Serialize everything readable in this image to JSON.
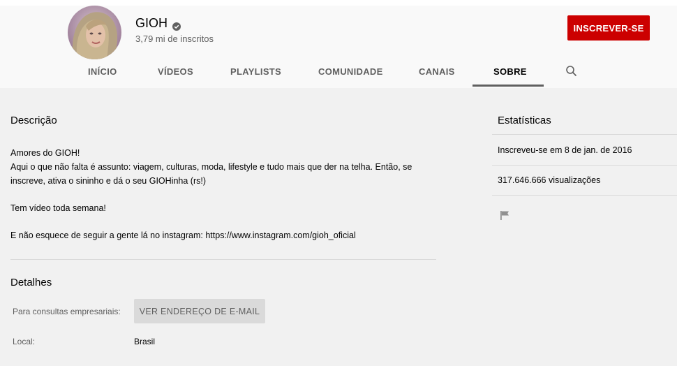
{
  "channel": {
    "name": "GIOH",
    "subscribers": "3,79 mi de inscritos",
    "avatar_icon": "avatar-image",
    "verified_icon": "verified-check-icon"
  },
  "subscribe_label": "INSCREVER-SE",
  "tabs": [
    {
      "label": "INÍCIO",
      "active": false
    },
    {
      "label": "VÍDEOS",
      "active": false
    },
    {
      "label": "PLAYLISTS",
      "active": false
    },
    {
      "label": "COMUNIDADE",
      "active": false
    },
    {
      "label": "CANAIS",
      "active": false
    },
    {
      "label": "SOBRE",
      "active": true
    }
  ],
  "search_icon": "search-icon",
  "description": {
    "title": "Descrição",
    "lines": [
      "Amores do GIOH!",
      "Aqui o que não falta é assunto: viagem, culturas, moda, lifestyle e tudo mais que der na telha. Então, se inscreve, ativa o sininho e dá o seu GIOHinha (rs!)",
      "Tem vídeo toda semana!",
      "E não esquece de seguir a gente lá no instagram: https://www.instagram.com/gioh_oficial"
    ]
  },
  "details": {
    "title": "Detalhes",
    "business_label": "Para consultas empresariais:",
    "email_button": "VER ENDEREÇO DE E-MAIL",
    "location_label": "Local:",
    "location_value": "Brasil"
  },
  "stats": {
    "title": "Estatísticas",
    "joined": "Inscreveu-se em 8 de jan. de 2016",
    "views": "317.646.666 visualizações",
    "flag_icon": "flag-icon"
  },
  "colors": {
    "subscribe": "#cc0000",
    "header_bg": "#f9f9f9",
    "content_bg": "#f1f1f1"
  }
}
